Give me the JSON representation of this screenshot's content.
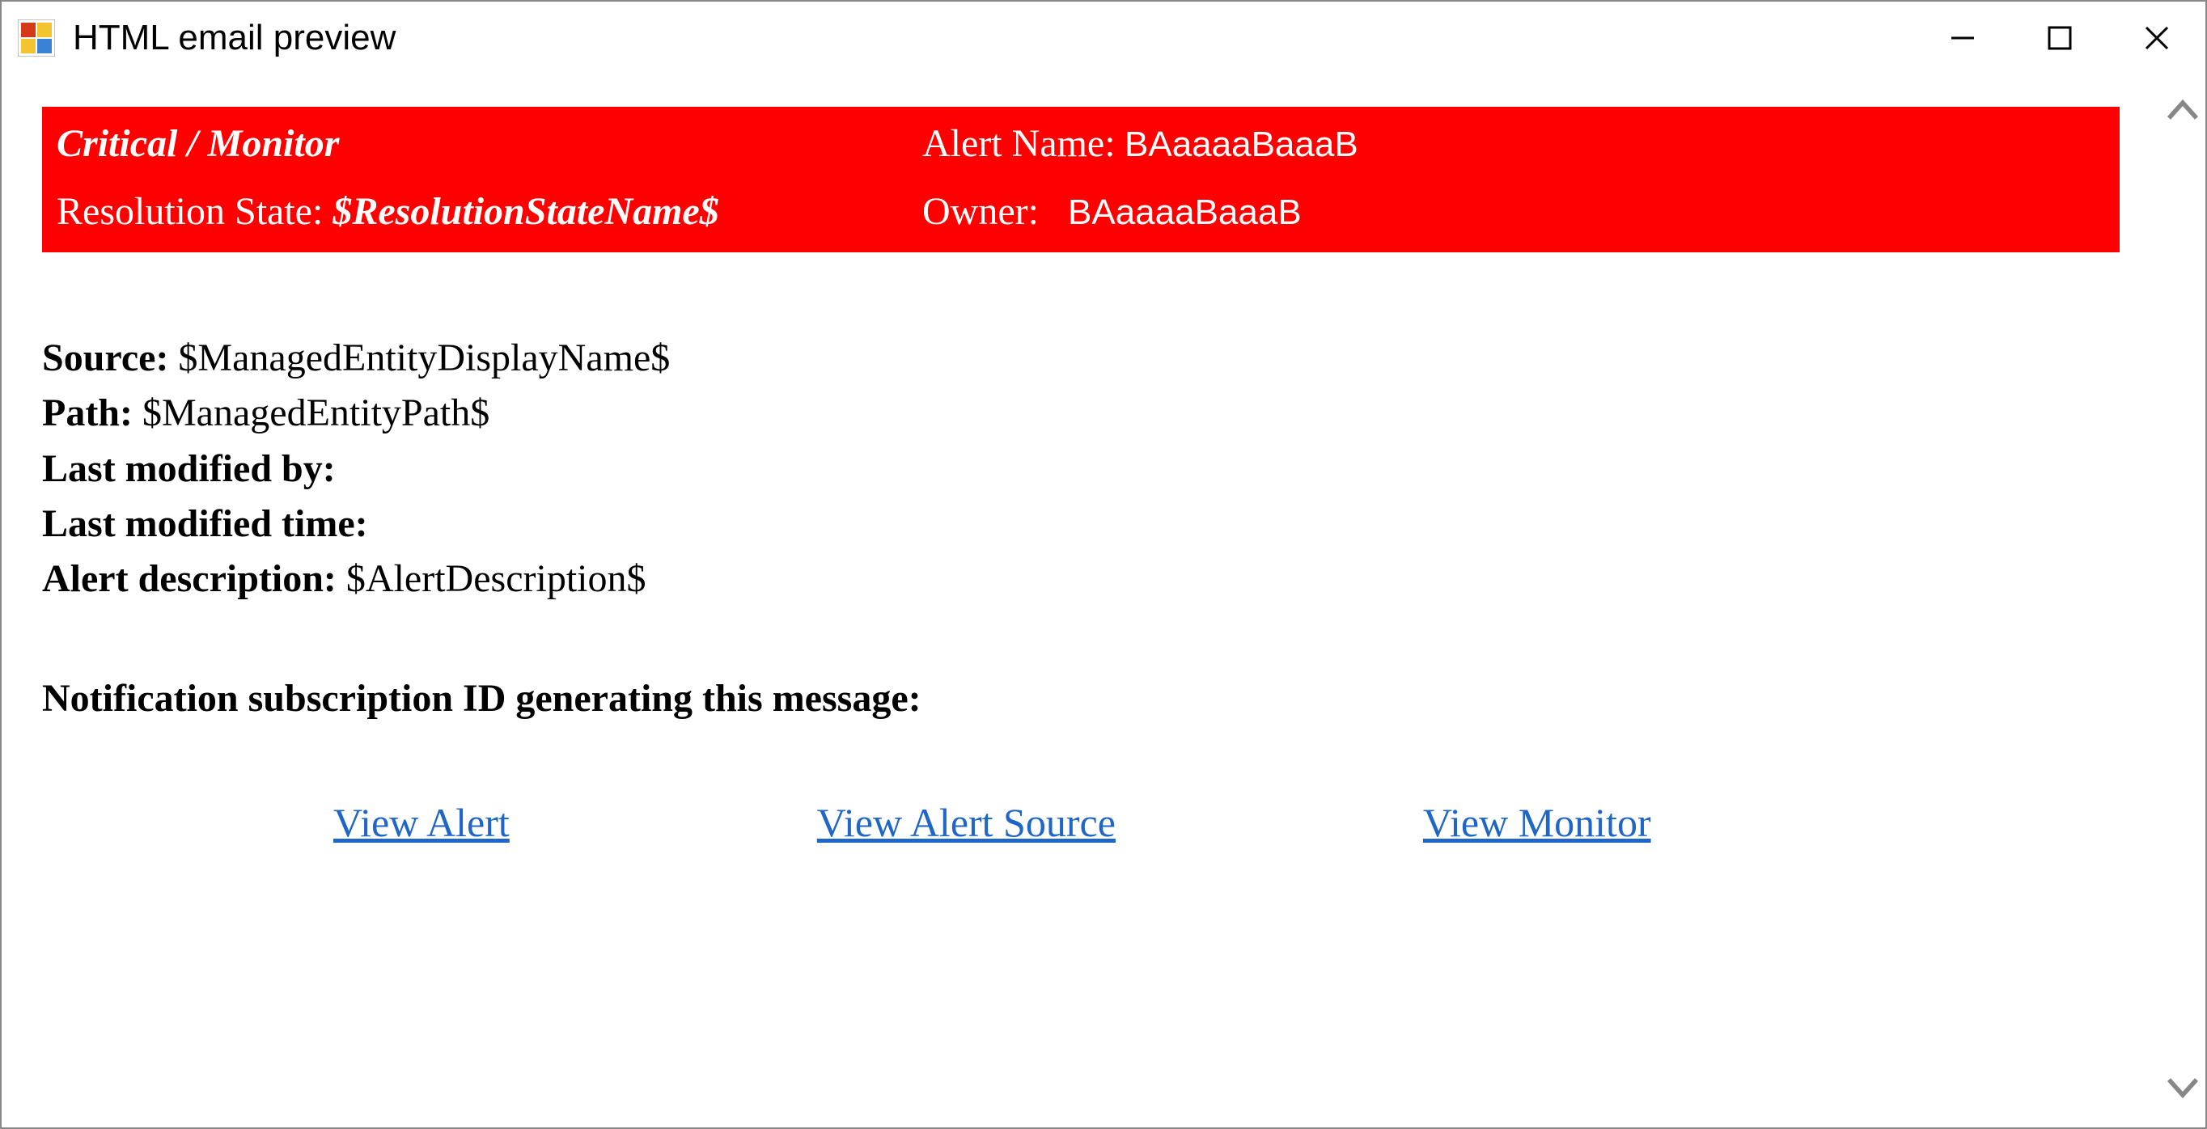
{
  "window": {
    "title": "HTML email preview"
  },
  "header": {
    "severity_type": "Critical / Monitor",
    "alert_name_label": "Alert Name:",
    "alert_name_value": "BAaaaaBaaaB",
    "resolution_state_label": "Resolution State:",
    "resolution_state_value": "$ResolutionStateName$",
    "owner_label": "Owner:",
    "owner_value": "BAaaaaBaaaB"
  },
  "body": {
    "source_label": "Source:",
    "source_value": " $ManagedEntityDisplayName$",
    "path_label": "Path:",
    "path_value": " $ManagedEntityPath$",
    "last_modified_by_label": "Last modified by:",
    "last_modified_by_value": "",
    "last_modified_time_label": "Last modified time:",
    "last_modified_time_value": "",
    "alert_description_label": "Alert description:",
    "alert_description_value": " $AlertDescription$",
    "subscription_label": "Notification subscription ID generating this message:"
  },
  "links": {
    "view_alert": "View Alert",
    "view_alert_source": "View Alert Source",
    "view_monitor": "View Monitor"
  },
  "colors": {
    "header_bg": "#ff0000",
    "link_color": "#1f66c7"
  }
}
